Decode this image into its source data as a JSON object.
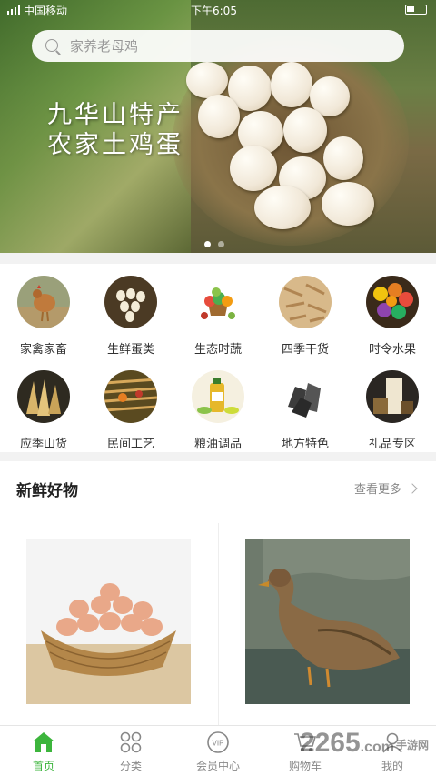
{
  "status_bar": {
    "carrier": "中国移动",
    "time": "下午6:05"
  },
  "search": {
    "placeholder": "家养老母鸡"
  },
  "banner": {
    "title_line1": "九华山特产",
    "title_line2": "农家土鸡蛋",
    "slide_count": 2,
    "active_slide": 1
  },
  "categories": [
    {
      "label": "家禽家畜",
      "icon": "poultry-icon"
    },
    {
      "label": "生鲜蛋类",
      "icon": "eggs-icon"
    },
    {
      "label": "生态时蔬",
      "icon": "vegetables-icon"
    },
    {
      "label": "四季干货",
      "icon": "dried-goods-icon"
    },
    {
      "label": "时令水果",
      "icon": "fruit-icon"
    },
    {
      "label": "应季山货",
      "icon": "bamboo-shoots-icon"
    },
    {
      "label": "民间工艺",
      "icon": "handicraft-icon"
    },
    {
      "label": "粮油调品",
      "icon": "oil-icon"
    },
    {
      "label": "地方特色",
      "icon": "charcoal-icon"
    },
    {
      "label": "礼品专区",
      "icon": "gift-icon"
    }
  ],
  "fresh": {
    "title": "新鲜好物",
    "more_label": "查看更多"
  },
  "tabbar": [
    {
      "label": "首页",
      "icon": "home-icon",
      "active": true
    },
    {
      "label": "分类",
      "icon": "category-icon",
      "active": false
    },
    {
      "label": "会员中心",
      "icon": "vip-icon",
      "active": false
    },
    {
      "label": "购物车",
      "icon": "cart-icon",
      "active": false
    },
    {
      "label": "我的",
      "icon": "profile-icon",
      "active": false
    }
  ],
  "watermark": {
    "text": "2265",
    "suffix": ".com",
    "sub": "手游网"
  },
  "colors": {
    "accent": "#3cb53c",
    "tab_inactive": "#888888"
  }
}
